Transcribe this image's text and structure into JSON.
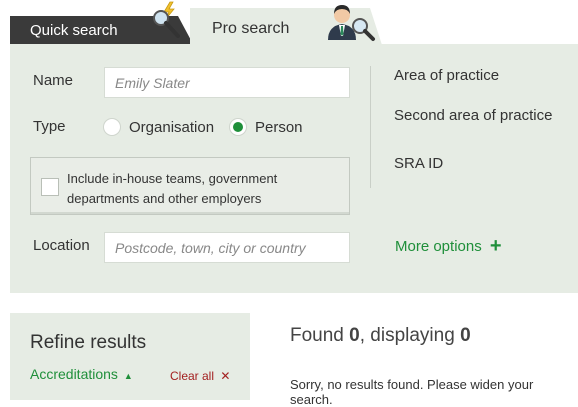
{
  "tabs": {
    "quick_search": "Quick search",
    "pro_search": "Pro search"
  },
  "form": {
    "name_label": "Name",
    "name_value": "Emily Slater",
    "type_label": "Type",
    "type_options": [
      "Organisation",
      "Person"
    ],
    "type_selected": "Person",
    "inhouse_label": "Include in-house teams, government departments and other employers",
    "inhouse_checked": false,
    "location_label": "Location",
    "location_placeholder": "Postcode, town, city or country"
  },
  "right_panel": {
    "area_of_practice": "Area of practice",
    "second_area_of_practice": "Second area of practice",
    "sra_id": "SRA ID",
    "more_options": "More options",
    "more_options_icon": "+"
  },
  "refine": {
    "title": "Refine results",
    "accreditations": "Accreditations",
    "accreditations_arrow": "▲",
    "clear_all": "Clear all",
    "clear_all_icon": "✕"
  },
  "results": {
    "found_prefix": "Found ",
    "found_count": "0",
    "displaying_prefix": ", displaying ",
    "displaying_count": "0",
    "message": "Sorry, no results found. Please widen your search."
  },
  "colors": {
    "panel_bg": "#e6ece4",
    "quick_tab_bg": "#3a3a3a",
    "accent_green": "#1f8f3a",
    "clear_red": "#a32020"
  },
  "icons": {
    "quick_search": "magnifier-lightning-icon",
    "pro_search": "businessman-magnifier-icon"
  }
}
